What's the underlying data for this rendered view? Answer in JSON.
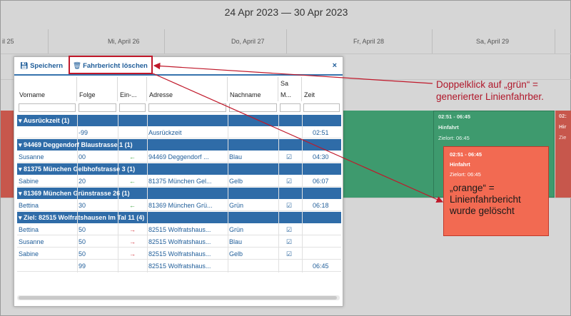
{
  "calendar": {
    "range_title": "24 Apr 2023 — 30 Apr 2023",
    "days": [
      "il 25",
      "Mi, April 26",
      "Do, April 27",
      "Fr, April 28",
      "Sa, April 29"
    ],
    "events": {
      "green_event": {
        "time": "02:51 - 06:45",
        "label": "Hinfahrt",
        "dest": "Zielort: 06:45"
      },
      "orange_event": {
        "time": "02:51 - 06:45",
        "label": "Hinfahrt",
        "dest": "Zielort: 06:45",
        "note": "„orange“ =\nLinienfahrbericht\nwurde gelöscht"
      },
      "right_partial": {
        "time": "02:",
        "label": "Hir",
        "dest": "Zie"
      }
    }
  },
  "callout": {
    "text": "Doppelklick auf „grün“ =\ngenerierter Linienfahrber."
  },
  "modal": {
    "save_label": "Speichern",
    "delete_label": "Fahrbericht löschen",
    "close_label": "×",
    "columns": {
      "vorname": "Vorname",
      "folge": "Folge",
      "ein": "Ein-...",
      "adresse": "Adresse",
      "nachname": "Nachname",
      "sa_top": "Sa",
      "m": "M...",
      "zeit": "Zeit"
    },
    "rows": [
      {
        "type": "group",
        "text": "Ausrückzeit (1)"
      },
      {
        "type": "data",
        "vorname": "",
        "folge": "-99",
        "ein": "",
        "adresse": "Ausrückzeit",
        "nachname": "",
        "m": false,
        "zeit": "02:51"
      },
      {
        "type": "group",
        "text": "94469 Deggendorf Blaustrasse 1 (1)"
      },
      {
        "type": "data",
        "vorname": "Susanne",
        "folge": "00",
        "ein": "left",
        "adresse": "94469 Deggendorf ...",
        "nachname": "Blau",
        "m": true,
        "zeit": "04:30"
      },
      {
        "type": "group",
        "text": "81375 München Gelbhofstrasse 3 (1)"
      },
      {
        "type": "data",
        "vorname": "Sabine",
        "folge": "20",
        "ein": "left",
        "adresse": "81375 München Gel...",
        "nachname": "Gelb",
        "m": true,
        "zeit": "06:07"
      },
      {
        "type": "group",
        "text": "81369 München Grünstrasse 26 (1)"
      },
      {
        "type": "data",
        "vorname": "Bettina",
        "folge": "30",
        "ein": "left",
        "adresse": "81369 München Grü...",
        "nachname": "Grün",
        "m": true,
        "zeit": "06:18"
      },
      {
        "type": "group",
        "text": "Ziel: 82515 Wolfratshausen Im Tal 11 (4)"
      },
      {
        "type": "data",
        "vorname": "Bettina",
        "folge": "50",
        "ein": "right",
        "adresse": "82515 Wolfratshaus...",
        "nachname": "Grün",
        "m": true,
        "zeit": ""
      },
      {
        "type": "data",
        "vorname": "Susanne",
        "folge": "50",
        "ein": "right",
        "adresse": "82515 Wolfratshaus...",
        "nachname": "Blau",
        "m": true,
        "zeit": ""
      },
      {
        "type": "data",
        "vorname": "Sabine",
        "folge": "50",
        "ein": "right",
        "adresse": "82515 Wolfratshaus...",
        "nachname": "Gelb",
        "m": true,
        "zeit": ""
      },
      {
        "type": "data",
        "vorname": "",
        "folge": "99",
        "ein": "",
        "adresse": "82515 Wolfratshaus...",
        "nachname": "",
        "m": false,
        "zeit": "06:45"
      }
    ]
  },
  "colors": {
    "accent": "#2f6ca8",
    "green_event": "#3e9a6e",
    "orange_event": "#f26a52",
    "annotation_red": "#c0182a"
  }
}
